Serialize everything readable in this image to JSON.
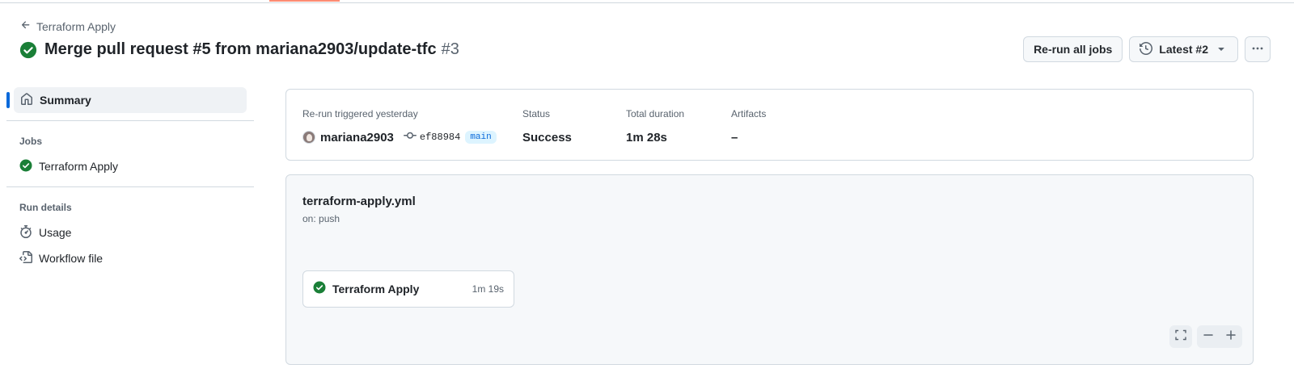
{
  "header": {
    "back_label": "Terraform Apply",
    "title": "Merge pull request #5 from mariana2903/update-tfc",
    "run_number": "#3",
    "rerun_label": "Re-run all jobs",
    "attempt_label": "Latest #2"
  },
  "sidebar": {
    "summary_label": "Summary",
    "jobs_heading": "Jobs",
    "jobs": [
      {
        "label": "Terraform Apply",
        "status": "success"
      }
    ],
    "run_details_heading": "Run details",
    "usage_label": "Usage",
    "workflow_file_label": "Workflow file"
  },
  "summary": {
    "trigger_label": "Re-run triggered yesterday",
    "actor": "mariana2903",
    "commit": "ef88984",
    "branch": "main",
    "status_label": "Status",
    "status_value": "Success",
    "duration_label": "Total duration",
    "duration_value": "1m 28s",
    "artifacts_label": "Artifacts",
    "artifacts_value": "–"
  },
  "workflow": {
    "file": "terraform-apply.yml",
    "trigger": "on: push",
    "job_name": "Terraform Apply",
    "job_duration": "1m 19s"
  },
  "colors": {
    "success": "#1a7f37",
    "accent": "#0969da",
    "tab_underline": "#fd8c73"
  },
  "icons": [
    "arrow-left-icon",
    "check-circle-fill-icon",
    "history-icon",
    "triangle-down-icon",
    "kebab-horizontal-icon",
    "home-icon",
    "stopwatch-icon",
    "file-code-icon",
    "git-commit-icon",
    "fullscreen-icon",
    "zoom-out-icon",
    "zoom-in-icon"
  ]
}
